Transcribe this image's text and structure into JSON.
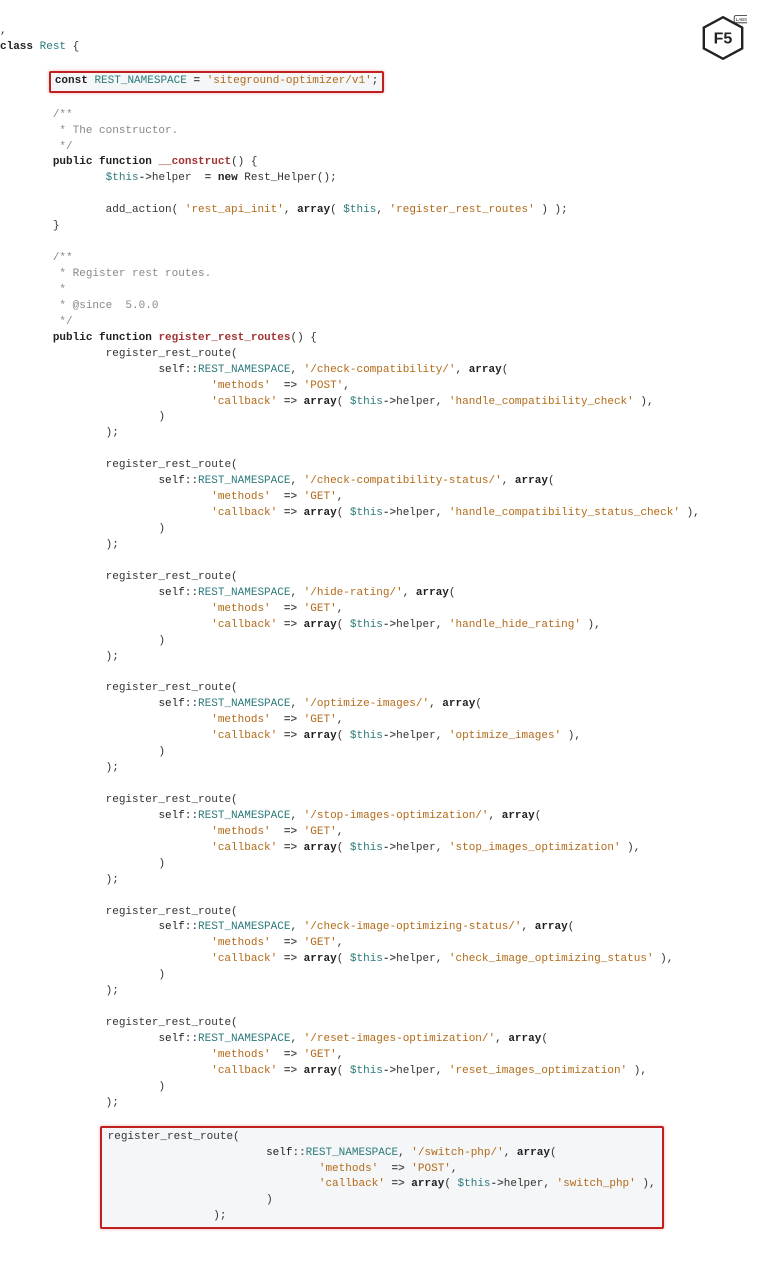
{
  "logo": {
    "text": "F5",
    "badge": "LABS"
  },
  "head": {
    "class_kw": "class",
    "class_name": "Rest",
    "brace_open": "{"
  },
  "hi1": {
    "const_kw": "const",
    "const_name": "REST_NAMESPACE",
    "eq": "=",
    "val": "'siteground-optimizer/v1'",
    "semi": ";"
  },
  "c1": {
    "l1": "/**",
    "l2": " * The constructor.",
    "l3": " */"
  },
  "ctor": {
    "public": "public",
    "function": "function",
    "name": "__construct",
    "parens": "()",
    "brace": "{",
    "this": "$this",
    "arrow": "->",
    "helper": "helper",
    "eq": "=",
    "new": "new",
    "rh": "Rest_Helper",
    "rhp": "();",
    "add_action": "add_action",
    "p1": "( ",
    "arg1": "'rest_api_init'",
    "comma": ", ",
    "array": "array",
    "p2": "( ",
    "this2": "$this",
    "comma2": ", ",
    "arg2": "'register_rest_routes'",
    "p3": " ) );",
    "close": "}"
  },
  "c2": {
    "l1": "/**",
    "l2": " * Register rest routes.",
    "l3": " *",
    "l4": " * @since  5.0.0",
    "l5": " */"
  },
  "rrr": {
    "public": "public",
    "function": "function",
    "name": "register_rest_routes",
    "parens": "()",
    "brace": "{"
  },
  "common": {
    "reg": "register_rest_route",
    "self": "self",
    "dcolon": "::",
    "ns": "REST_NAMESPACE",
    "arr": "array",
    "methods": "'methods'",
    "callback": "'callback'",
    "darrow": "=>",
    "this": "$this",
    "tarrow": "->",
    "helper": "helper",
    "p_open": "(",
    "p_close": ")",
    "comma_sp": ", ",
    "semi": ";"
  },
  "routes": [
    {
      "path": "'/check-compatibility/'",
      "method": "'POST'",
      "cb": "'handle_compatibility_check'"
    },
    {
      "path": "'/check-compatibility-status/'",
      "method": "'GET'",
      "cb": "'handle_compatibility_status_check'"
    },
    {
      "path": "'/hide-rating/'",
      "method": "'GET'",
      "cb": "'handle_hide_rating'"
    },
    {
      "path": "'/optimize-images/'",
      "method": "'GET'",
      "cb": "'optimize_images'"
    },
    {
      "path": "'/stop-images-optimization/'",
      "method": "'GET'",
      "cb": "'stop_images_optimization'"
    },
    {
      "path": "'/check-image-optimizing-status/'",
      "method": "'GET'",
      "cb": "'check_image_optimizing_status'"
    },
    {
      "path": "'/reset-images-optimization/'",
      "method": "'GET'",
      "cb": "'reset_images_optimization'"
    },
    {
      "path": "'/switch-php/'",
      "method": "'POST'",
      "cb": "'switch_php'"
    }
  ]
}
